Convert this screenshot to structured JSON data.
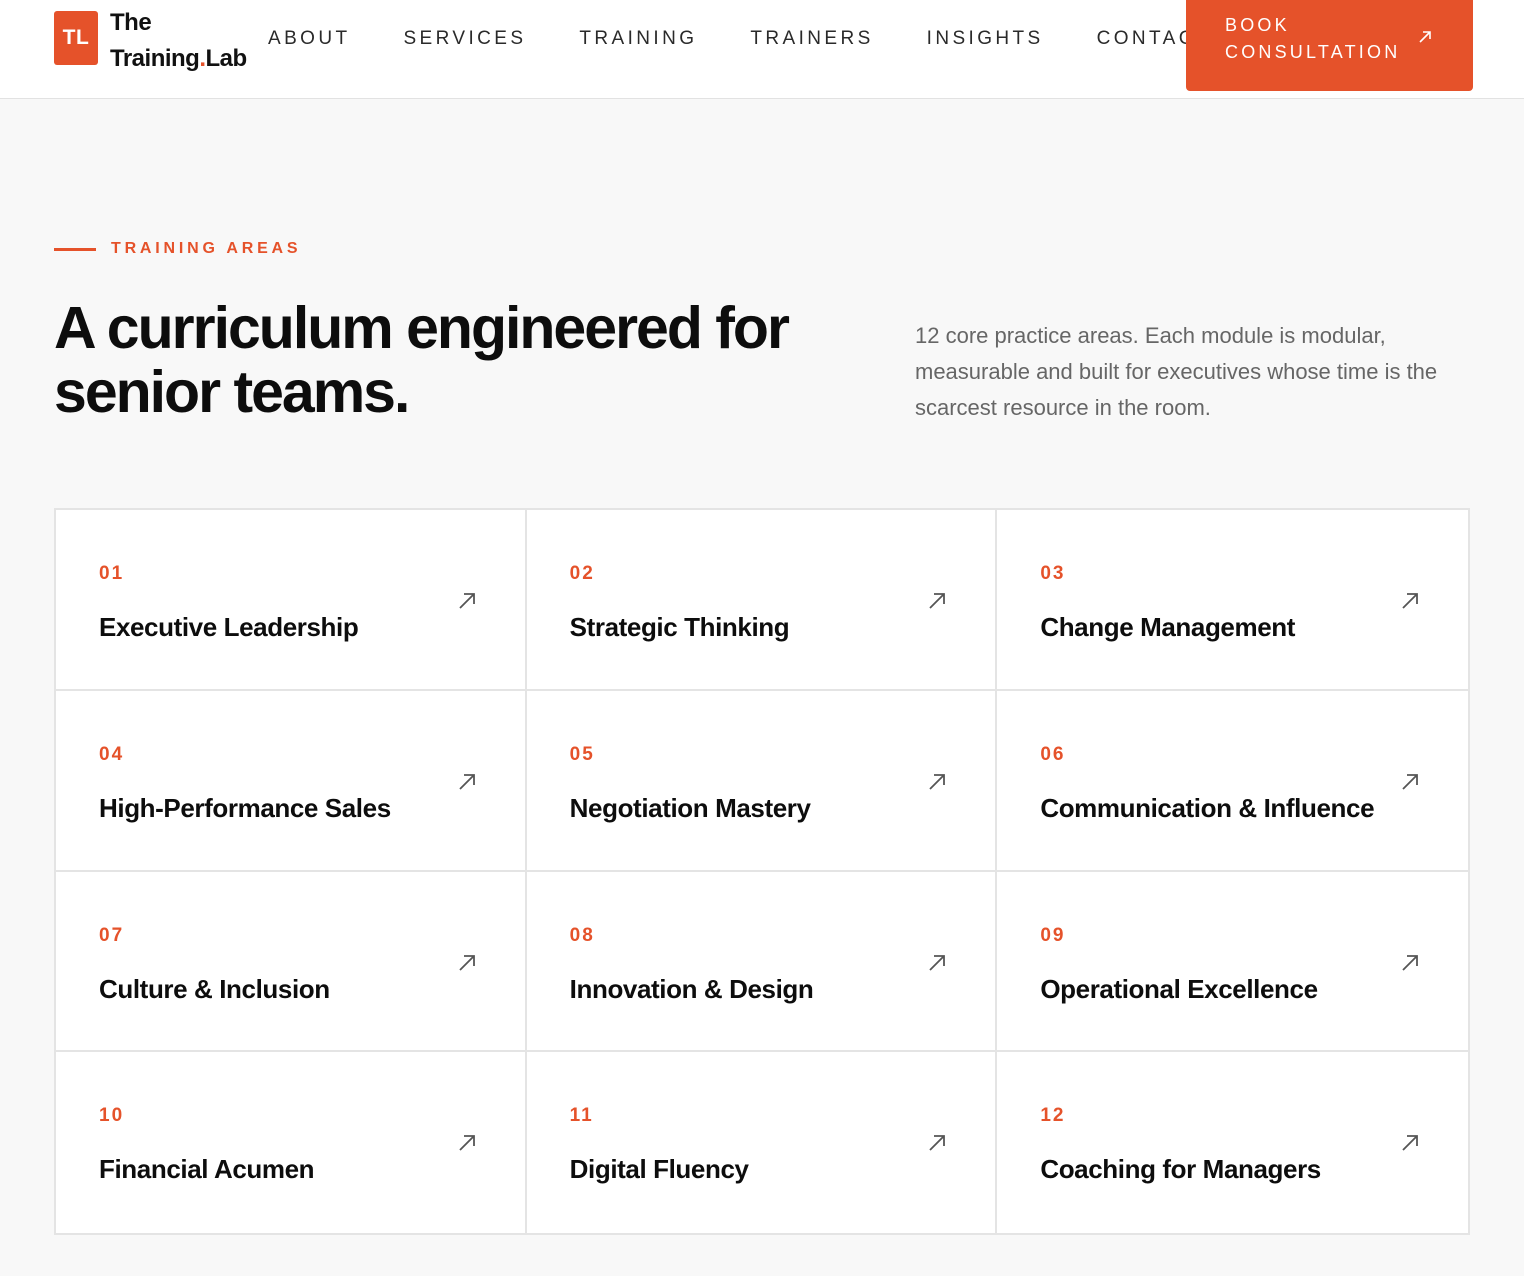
{
  "header": {
    "logo_mark": "TL",
    "logo_line1": "The",
    "logo_line2_a": "Training",
    "logo_line2_dot": ".",
    "logo_line2_b": "Lab",
    "nav": [
      "ABOUT",
      "SERVICES",
      "TRAINING",
      "TRAINERS",
      "INSIGHTS",
      "CONTACT"
    ],
    "cta_line1": "BOOK",
    "cta_line2": "CONSULTATION",
    "cta_icon": "arrow-up-right-icon"
  },
  "section": {
    "eyebrow": "TRAINING AREAS",
    "headline_line1": "A curriculum engineered for",
    "headline_line2": "senior teams.",
    "intro": "12 core practice areas. Each module is modular, measurable and built for executives whose time is the scarcest resource in the room."
  },
  "areas": [
    {
      "num": "01",
      "title": "Executive Leadership"
    },
    {
      "num": "02",
      "title": "Strategic Thinking"
    },
    {
      "num": "03",
      "title": "Change Management"
    },
    {
      "num": "04",
      "title": "High-Performance Sales"
    },
    {
      "num": "05",
      "title": "Negotiation Mastery"
    },
    {
      "num": "06",
      "title": "Communication & Influence"
    },
    {
      "num": "07",
      "title": "Culture & Inclusion"
    },
    {
      "num": "08",
      "title": "Innovation & Design"
    },
    {
      "num": "09",
      "title": "Operational Excellence"
    },
    {
      "num": "10",
      "title": "Financial Acumen"
    },
    {
      "num": "11",
      "title": "Digital Fluency"
    },
    {
      "num": "12",
      "title": "Coaching for Managers"
    }
  ],
  "colors": {
    "accent": "#e5522a",
    "text": "#0d0d0d",
    "muted": "#666666",
    "background": "#f8f8f8",
    "border": "#e4e4e4"
  }
}
